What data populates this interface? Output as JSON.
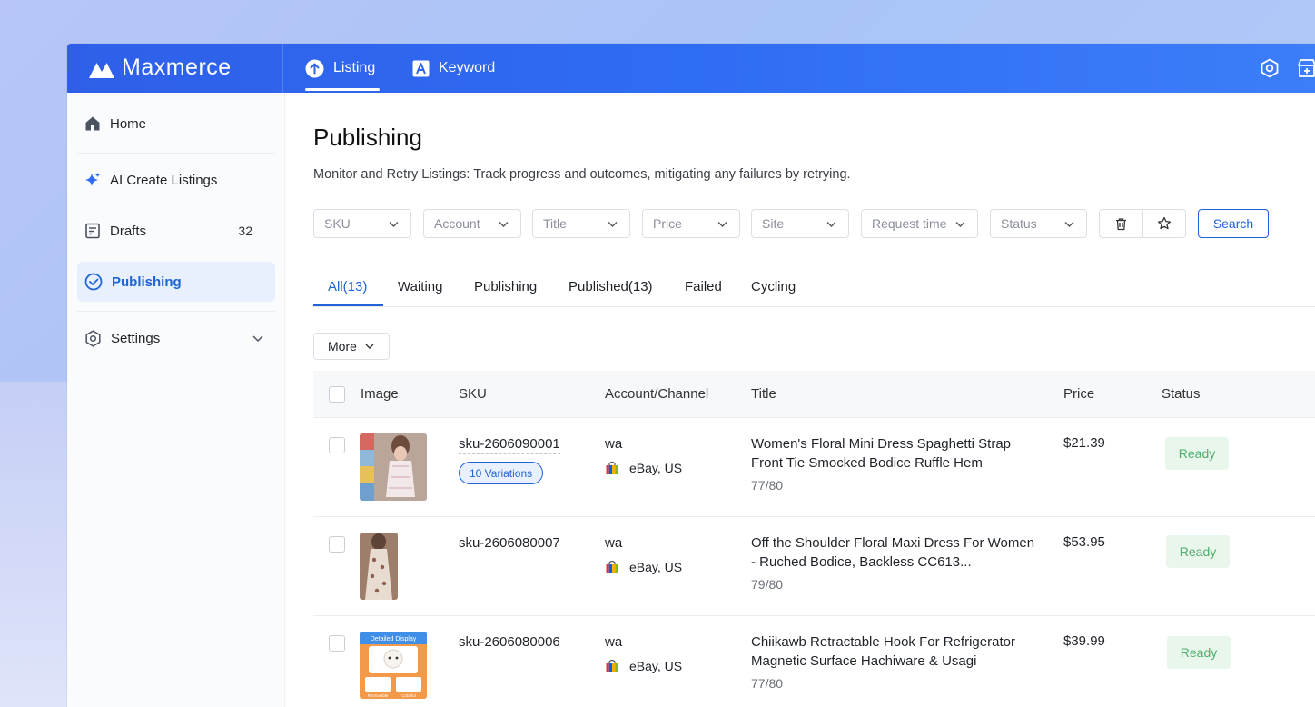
{
  "app": {
    "name": "Maxmerce"
  },
  "topnav": {
    "tabs": [
      {
        "label": "Listing",
        "icon": "arrow-up-circle-icon",
        "active": true
      },
      {
        "label": "Keyword",
        "icon": "font-a-icon",
        "active": false
      }
    ],
    "right_icons": [
      "settings-hex-icon",
      "store-add-icon"
    ]
  },
  "sidebar": {
    "items": [
      {
        "label": "Home",
        "icon": "home-icon"
      },
      {
        "label": "AI Create Listings",
        "icon": "sparkle-icon"
      },
      {
        "label": "Drafts",
        "icon": "drafts-icon",
        "count": "32"
      },
      {
        "label": "Publishing",
        "icon": "check-circle-icon",
        "active": true
      },
      {
        "label": "Settings",
        "icon": "settings-icon"
      }
    ]
  },
  "page": {
    "title": "Publishing",
    "description": "Monitor and Retry Listings: Track progress and outcomes, mitigating any failures by retrying."
  },
  "filters": {
    "items": [
      "SKU",
      "Account",
      "Title",
      "Price",
      "Site",
      "Request time",
      "Status"
    ],
    "search_label": "Search"
  },
  "status_tabs": [
    "All(13)",
    "Waiting",
    "Publishing",
    "Published(13)",
    "Failed",
    "Cycling"
  ],
  "more_label": "More",
  "table": {
    "columns": [
      "Image",
      "SKU",
      "Account/Channel",
      "Title",
      "Price",
      "Status"
    ],
    "rows": [
      {
        "sku": "sku-2606090001",
        "variations": "10 Variations",
        "account": "wa",
        "channel": "eBay, US",
        "title": "Women's Floral Mini Dress Spaghetti Strap Front Tie Smocked Bodice Ruffle Hem",
        "title_count": "77/80",
        "price": "$21.39",
        "status": "Ready"
      },
      {
        "sku": "sku-2606080007",
        "account": "wa",
        "channel": "eBay, US",
        "title": "Off the Shoulder Floral Maxi Dress For Women - Ruched Bodice, Backless CC613...",
        "title_count": "79/80",
        "price": "$53.95",
        "status": "Ready"
      },
      {
        "sku": "sku-2606080006",
        "account": "wa",
        "channel": "eBay, US",
        "title": "Chiikawb Retractable Hook For Refrigerator Magnetic Surface Hachiware & Usagi",
        "title_count": "77/80",
        "price": "$39.99",
        "status": "Ready",
        "image_text": [
          "Detailed Display",
          "Removable",
          "Colorful"
        ]
      }
    ]
  },
  "colors": {
    "brand": "#2f6cf4",
    "accent": "#1f63d8",
    "ready_bg": "#e8f6ec",
    "ready_text": "#4fae6a"
  }
}
